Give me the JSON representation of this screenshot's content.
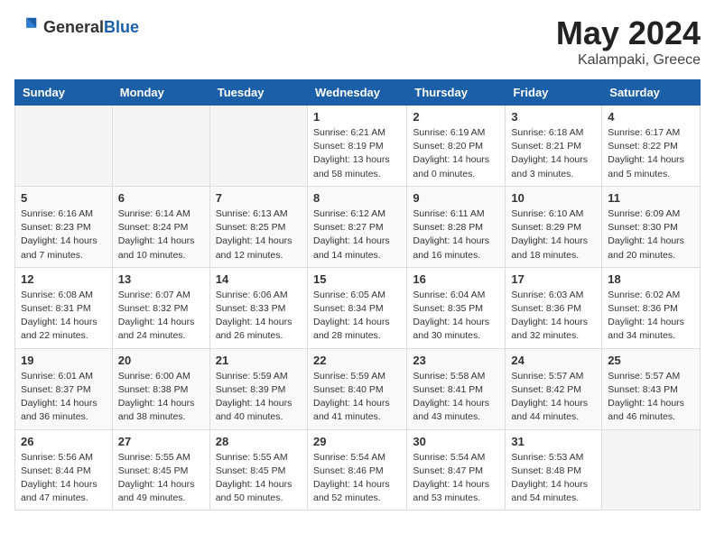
{
  "header": {
    "logo_general": "General",
    "logo_blue": "Blue",
    "title": "May 2024",
    "location": "Kalampaki, Greece"
  },
  "weekdays": [
    "Sunday",
    "Monday",
    "Tuesday",
    "Wednesday",
    "Thursday",
    "Friday",
    "Saturday"
  ],
  "weeks": [
    [
      {
        "day": "",
        "sunrise": "",
        "sunset": "",
        "daylight": ""
      },
      {
        "day": "",
        "sunrise": "",
        "sunset": "",
        "daylight": ""
      },
      {
        "day": "",
        "sunrise": "",
        "sunset": "",
        "daylight": ""
      },
      {
        "day": "1",
        "sunrise": "Sunrise: 6:21 AM",
        "sunset": "Sunset: 8:19 PM",
        "daylight": "Daylight: 13 hours and 58 minutes."
      },
      {
        "day": "2",
        "sunrise": "Sunrise: 6:19 AM",
        "sunset": "Sunset: 8:20 PM",
        "daylight": "Daylight: 14 hours and 0 minutes."
      },
      {
        "day": "3",
        "sunrise": "Sunrise: 6:18 AM",
        "sunset": "Sunset: 8:21 PM",
        "daylight": "Daylight: 14 hours and 3 minutes."
      },
      {
        "day": "4",
        "sunrise": "Sunrise: 6:17 AM",
        "sunset": "Sunset: 8:22 PM",
        "daylight": "Daylight: 14 hours and 5 minutes."
      }
    ],
    [
      {
        "day": "5",
        "sunrise": "Sunrise: 6:16 AM",
        "sunset": "Sunset: 8:23 PM",
        "daylight": "Daylight: 14 hours and 7 minutes."
      },
      {
        "day": "6",
        "sunrise": "Sunrise: 6:14 AM",
        "sunset": "Sunset: 8:24 PM",
        "daylight": "Daylight: 14 hours and 10 minutes."
      },
      {
        "day": "7",
        "sunrise": "Sunrise: 6:13 AM",
        "sunset": "Sunset: 8:25 PM",
        "daylight": "Daylight: 14 hours and 12 minutes."
      },
      {
        "day": "8",
        "sunrise": "Sunrise: 6:12 AM",
        "sunset": "Sunset: 8:27 PM",
        "daylight": "Daylight: 14 hours and 14 minutes."
      },
      {
        "day": "9",
        "sunrise": "Sunrise: 6:11 AM",
        "sunset": "Sunset: 8:28 PM",
        "daylight": "Daylight: 14 hours and 16 minutes."
      },
      {
        "day": "10",
        "sunrise": "Sunrise: 6:10 AM",
        "sunset": "Sunset: 8:29 PM",
        "daylight": "Daylight: 14 hours and 18 minutes."
      },
      {
        "day": "11",
        "sunrise": "Sunrise: 6:09 AM",
        "sunset": "Sunset: 8:30 PM",
        "daylight": "Daylight: 14 hours and 20 minutes."
      }
    ],
    [
      {
        "day": "12",
        "sunrise": "Sunrise: 6:08 AM",
        "sunset": "Sunset: 8:31 PM",
        "daylight": "Daylight: 14 hours and 22 minutes."
      },
      {
        "day": "13",
        "sunrise": "Sunrise: 6:07 AM",
        "sunset": "Sunset: 8:32 PM",
        "daylight": "Daylight: 14 hours and 24 minutes."
      },
      {
        "day": "14",
        "sunrise": "Sunrise: 6:06 AM",
        "sunset": "Sunset: 8:33 PM",
        "daylight": "Daylight: 14 hours and 26 minutes."
      },
      {
        "day": "15",
        "sunrise": "Sunrise: 6:05 AM",
        "sunset": "Sunset: 8:34 PM",
        "daylight": "Daylight: 14 hours and 28 minutes."
      },
      {
        "day": "16",
        "sunrise": "Sunrise: 6:04 AM",
        "sunset": "Sunset: 8:35 PM",
        "daylight": "Daylight: 14 hours and 30 minutes."
      },
      {
        "day": "17",
        "sunrise": "Sunrise: 6:03 AM",
        "sunset": "Sunset: 8:36 PM",
        "daylight": "Daylight: 14 hours and 32 minutes."
      },
      {
        "day": "18",
        "sunrise": "Sunrise: 6:02 AM",
        "sunset": "Sunset: 8:36 PM",
        "daylight": "Daylight: 14 hours and 34 minutes."
      }
    ],
    [
      {
        "day": "19",
        "sunrise": "Sunrise: 6:01 AM",
        "sunset": "Sunset: 8:37 PM",
        "daylight": "Daylight: 14 hours and 36 minutes."
      },
      {
        "day": "20",
        "sunrise": "Sunrise: 6:00 AM",
        "sunset": "Sunset: 8:38 PM",
        "daylight": "Daylight: 14 hours and 38 minutes."
      },
      {
        "day": "21",
        "sunrise": "Sunrise: 5:59 AM",
        "sunset": "Sunset: 8:39 PM",
        "daylight": "Daylight: 14 hours and 40 minutes."
      },
      {
        "day": "22",
        "sunrise": "Sunrise: 5:59 AM",
        "sunset": "Sunset: 8:40 PM",
        "daylight": "Daylight: 14 hours and 41 minutes."
      },
      {
        "day": "23",
        "sunrise": "Sunrise: 5:58 AM",
        "sunset": "Sunset: 8:41 PM",
        "daylight": "Daylight: 14 hours and 43 minutes."
      },
      {
        "day": "24",
        "sunrise": "Sunrise: 5:57 AM",
        "sunset": "Sunset: 8:42 PM",
        "daylight": "Daylight: 14 hours and 44 minutes."
      },
      {
        "day": "25",
        "sunrise": "Sunrise: 5:57 AM",
        "sunset": "Sunset: 8:43 PM",
        "daylight": "Daylight: 14 hours and 46 minutes."
      }
    ],
    [
      {
        "day": "26",
        "sunrise": "Sunrise: 5:56 AM",
        "sunset": "Sunset: 8:44 PM",
        "daylight": "Daylight: 14 hours and 47 minutes."
      },
      {
        "day": "27",
        "sunrise": "Sunrise: 5:55 AM",
        "sunset": "Sunset: 8:45 PM",
        "daylight": "Daylight: 14 hours and 49 minutes."
      },
      {
        "day": "28",
        "sunrise": "Sunrise: 5:55 AM",
        "sunset": "Sunset: 8:45 PM",
        "daylight": "Daylight: 14 hours and 50 minutes."
      },
      {
        "day": "29",
        "sunrise": "Sunrise: 5:54 AM",
        "sunset": "Sunset: 8:46 PM",
        "daylight": "Daylight: 14 hours and 52 minutes."
      },
      {
        "day": "30",
        "sunrise": "Sunrise: 5:54 AM",
        "sunset": "Sunset: 8:47 PM",
        "daylight": "Daylight: 14 hours and 53 minutes."
      },
      {
        "day": "31",
        "sunrise": "Sunrise: 5:53 AM",
        "sunset": "Sunset: 8:48 PM",
        "daylight": "Daylight: 14 hours and 54 minutes."
      },
      {
        "day": "",
        "sunrise": "",
        "sunset": "",
        "daylight": ""
      }
    ]
  ]
}
